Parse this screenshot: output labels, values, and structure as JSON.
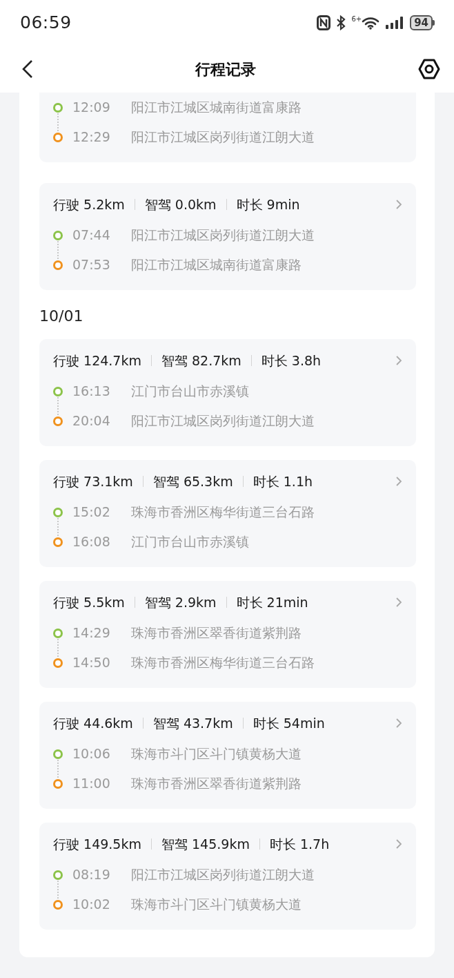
{
  "status_bar": {
    "time": "06:59",
    "wifi_label": "6+",
    "battery": "94"
  },
  "header": {
    "title": "行程记录"
  },
  "groups": [
    {
      "trips": [
        {
          "route": [
            {
              "time": "12:09",
              "place": "阳江市江城区城南街道富康路"
            },
            {
              "time": "12:29",
              "place": "阳江市江城区岗列街道江朗大道"
            }
          ]
        },
        {
          "stats": [
            {
              "label": "行驶",
              "value": "5.2km"
            },
            {
              "label": "智驾",
              "value": "0.0km"
            },
            {
              "label": "时长",
              "value": "9min"
            }
          ],
          "route": [
            {
              "time": "07:44",
              "place": "阳江市江城区岗列街道江朗大道"
            },
            {
              "time": "07:53",
              "place": "阳江市江城区城南街道富康路"
            }
          ]
        }
      ]
    },
    {
      "date": "10/01",
      "trips": [
        {
          "stats": [
            {
              "label": "行驶",
              "value": "124.7km"
            },
            {
              "label": "智驾",
              "value": "82.7km"
            },
            {
              "label": "时长",
              "value": "3.8h"
            }
          ],
          "route": [
            {
              "time": "16:13",
              "place": "江门市台山市赤溪镇"
            },
            {
              "time": "20:04",
              "place": "阳江市江城区岗列街道江朗大道"
            }
          ]
        },
        {
          "stats": [
            {
              "label": "行驶",
              "value": "73.1km"
            },
            {
              "label": "智驾",
              "value": "65.3km"
            },
            {
              "label": "时长",
              "value": "1.1h"
            }
          ],
          "route": [
            {
              "time": "15:02",
              "place": "珠海市香洲区梅华街道三台石路"
            },
            {
              "time": "16:08",
              "place": "江门市台山市赤溪镇"
            }
          ]
        },
        {
          "stats": [
            {
              "label": "行驶",
              "value": "5.5km"
            },
            {
              "label": "智驾",
              "value": "2.9km"
            },
            {
              "label": "时长",
              "value": "21min"
            }
          ],
          "route": [
            {
              "time": "14:29",
              "place": "珠海市香洲区翠香街道紫荆路"
            },
            {
              "time": "14:50",
              "place": "珠海市香洲区梅华街道三台石路"
            }
          ]
        },
        {
          "stats": [
            {
              "label": "行驶",
              "value": "44.6km"
            },
            {
              "label": "智驾",
              "value": "43.7km"
            },
            {
              "label": "时长",
              "value": "54min"
            }
          ],
          "route": [
            {
              "time": "10:06",
              "place": "珠海市斗门区斗门镇黄杨大道"
            },
            {
              "time": "11:00",
              "place": "珠海市香洲区翠香街道紫荆路"
            }
          ]
        },
        {
          "stats": [
            {
              "label": "行驶",
              "value": "149.5km"
            },
            {
              "label": "智驾",
              "value": "145.9km"
            },
            {
              "label": "时长",
              "value": "1.7h"
            }
          ],
          "route": [
            {
              "time": "08:19",
              "place": "阳江市江城区岗列街道江朗大道"
            },
            {
              "time": "10:02",
              "place": "珠海市斗门区斗门镇黄杨大道"
            }
          ]
        }
      ]
    }
  ]
}
